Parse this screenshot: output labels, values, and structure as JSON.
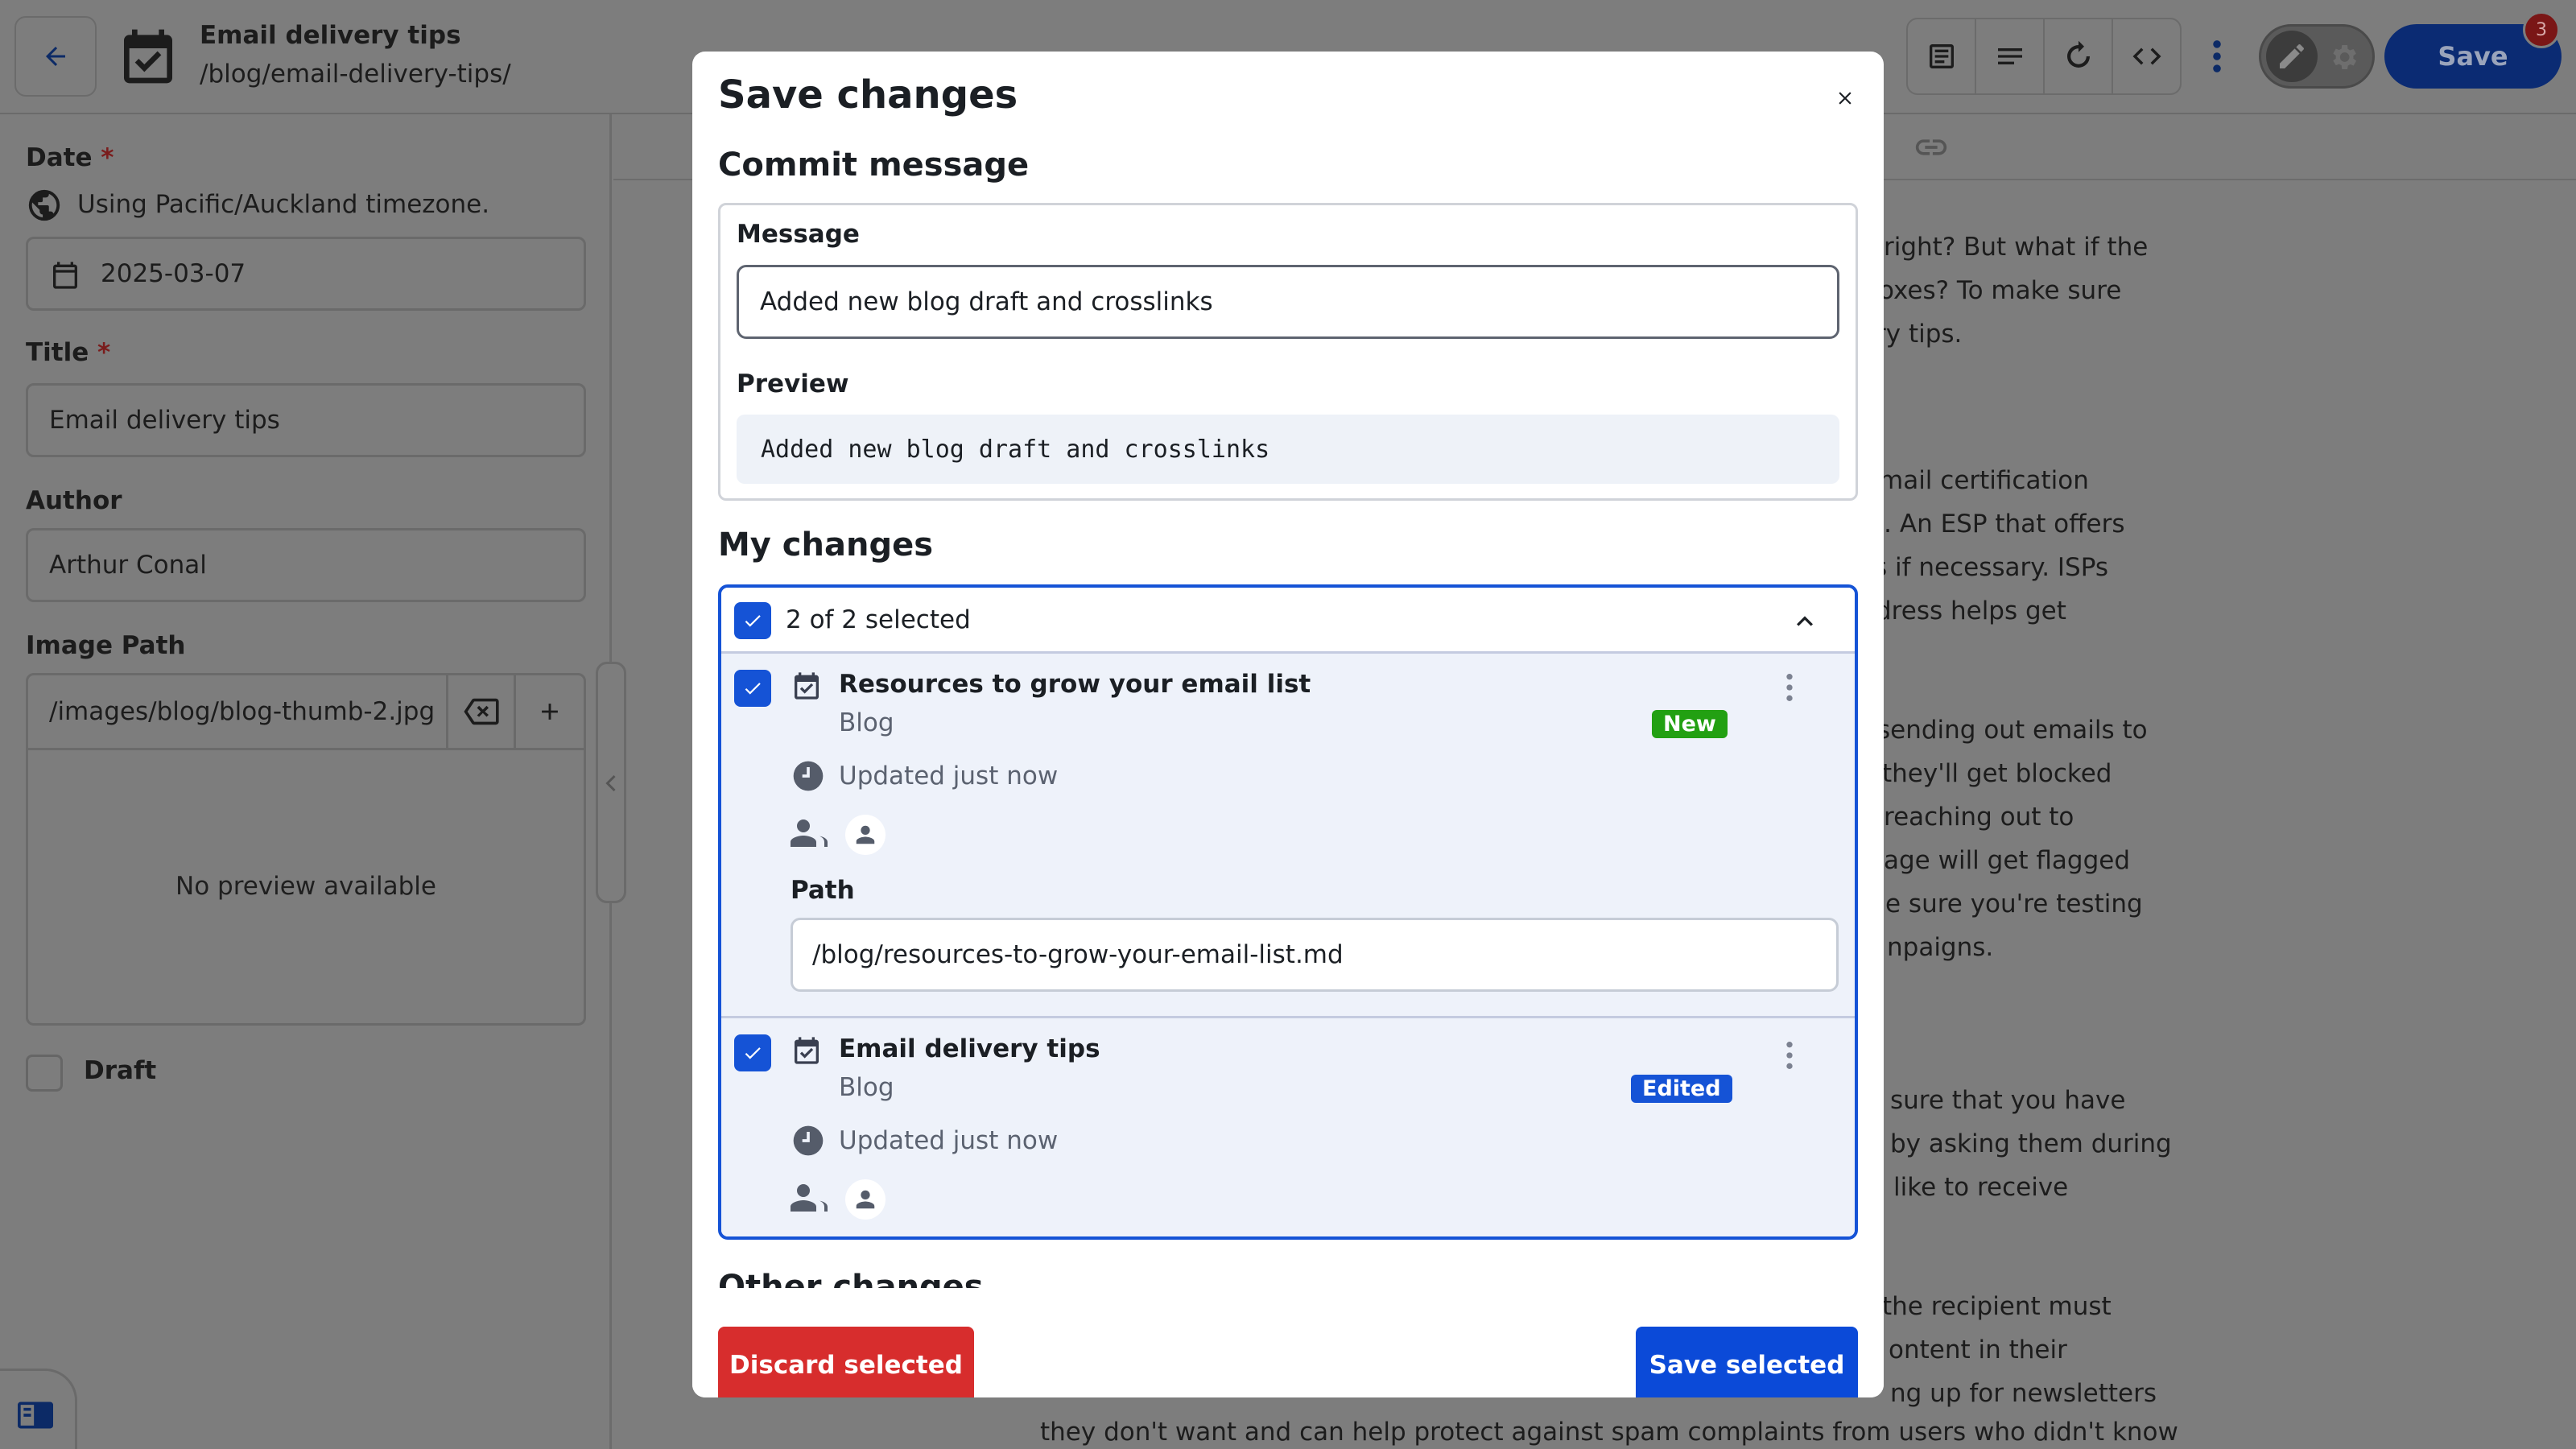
{
  "header": {
    "entry_title": "Email delivery tips",
    "entry_path": "/blog/email-delivery-tips/",
    "save_label": "Save",
    "save_badge": "3"
  },
  "sidebar": {
    "date_label": "Date",
    "required_mark": "*",
    "timezone_note": "Using Pacific/Auckland timezone.",
    "date_value": "2025-03-07",
    "title_label": "Title",
    "title_value": "Email delivery tips",
    "author_label": "Author",
    "author_value": "Arthur Conal",
    "image_label": "Image Path",
    "image_value": "/images/blog/blog-thumb-2.jpg",
    "image_preview": "No preview available",
    "draft_label": "Draft"
  },
  "background_text": [
    "right? But what if the",
    "oxes? To make sure",
    "ry tips.",
    "mail certification",
    "s. An ESP that offers",
    "s if necessary. ISPs",
    "dress helps get",
    "sending out emails to",
    "they'll get blocked",
    "reaching out to",
    "age will get flagged",
    "e sure you're testing",
    "npaigns.",
    "sure that you have",
    "by asking them during",
    "like to receive",
    "the recipient must",
    "ontent in their",
    "ng up for newsletters",
    "they don't want and can help protect against spam complaints from users who didn't know"
  ],
  "dialog": {
    "title": "Save changes",
    "commit_heading": "Commit message",
    "message_label": "Message",
    "message_value": "Added new blog draft and crosslinks",
    "preview_label": "Preview",
    "preview_value": "Added new blog draft and crosslinks",
    "my_changes_heading": "My changes",
    "selection_summary": "2 of 2 selected",
    "items": [
      {
        "title": "Resources to grow your email list",
        "collection": "Blog",
        "updated": "Updated just now",
        "badge": "New",
        "path_label": "Path",
        "path_value": "/blog/resources-to-grow-your-email-list.md"
      },
      {
        "title": "Email delivery tips",
        "collection": "Blog",
        "updated": "Updated just now",
        "badge": "Edited"
      }
    ],
    "others_heading_peek": "Other changes",
    "discard_label": "Discard selected",
    "save_selected_label": "Save selected"
  },
  "colors": {
    "accent": "#1553d6",
    "danger": "#d72d2d",
    "success": "#22a012",
    "overlay": "#7d7d7d"
  }
}
